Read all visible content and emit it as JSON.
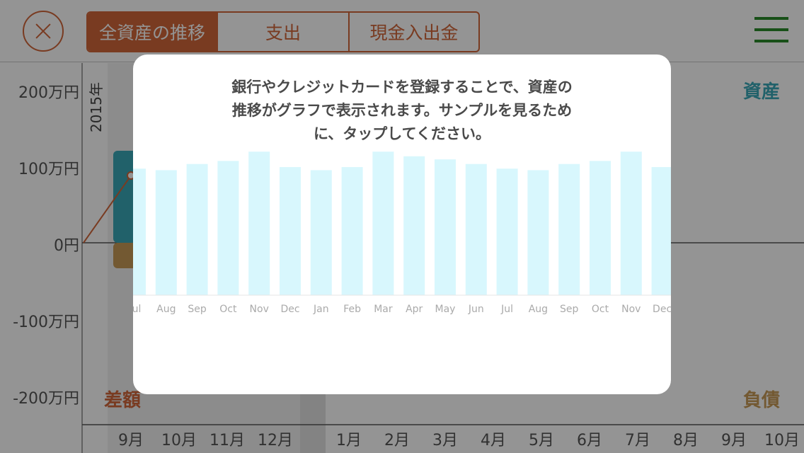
{
  "topbar": {
    "close_icon": "close-circle-icon",
    "tabs": [
      {
        "label": "全資産の推移",
        "active": true
      },
      {
        "label": "支出",
        "active": false
      },
      {
        "label": "現金入出金",
        "active": false
      }
    ],
    "menu_icon": "hamburger-menu-icon"
  },
  "background_chart": {
    "y_ticks": [
      "200万円",
      "100万円",
      "0円",
      "-100万円",
      "-200万円"
    ],
    "year_label": "2015年",
    "assets_label": "資産",
    "diff_label": "差額",
    "liabilities_label": "負債",
    "months": [
      "9月",
      "10月",
      "11月",
      "12月",
      "1月",
      "2月",
      "3月",
      "4月",
      "5月",
      "6月",
      "7月",
      "8月",
      "9月",
      "10月"
    ],
    "colors": {
      "assets": "#3aa7b7",
      "liabilities": "#c79a56",
      "diff": "#d0663a"
    }
  },
  "modal": {
    "message_lines": [
      "銀行やクレジットカードを登録することで、資産の",
      "推移がグラフで表示されます。サンプルを見るため",
      "に、タップしてください。"
    ]
  },
  "chart_data": {
    "type": "bar",
    "categories": [
      "Jul",
      "Aug",
      "Sep",
      "Oct",
      "Nov",
      "Dec",
      "Jan",
      "Feb",
      "Mar",
      "Apr",
      "May",
      "Jun",
      "Jul",
      "Aug",
      "Sep",
      "Oct",
      "Nov",
      "Dec"
    ],
    "values": [
      82,
      81,
      85,
      87,
      93,
      83,
      81,
      83,
      93,
      90,
      88,
      85,
      82,
      81,
      85,
      87,
      93,
      83
    ],
    "ylim": [
      0,
      100
    ],
    "title": "",
    "xlabel": "",
    "ylabel": "",
    "bar_color": "#d8f7fd",
    "grid": false
  }
}
